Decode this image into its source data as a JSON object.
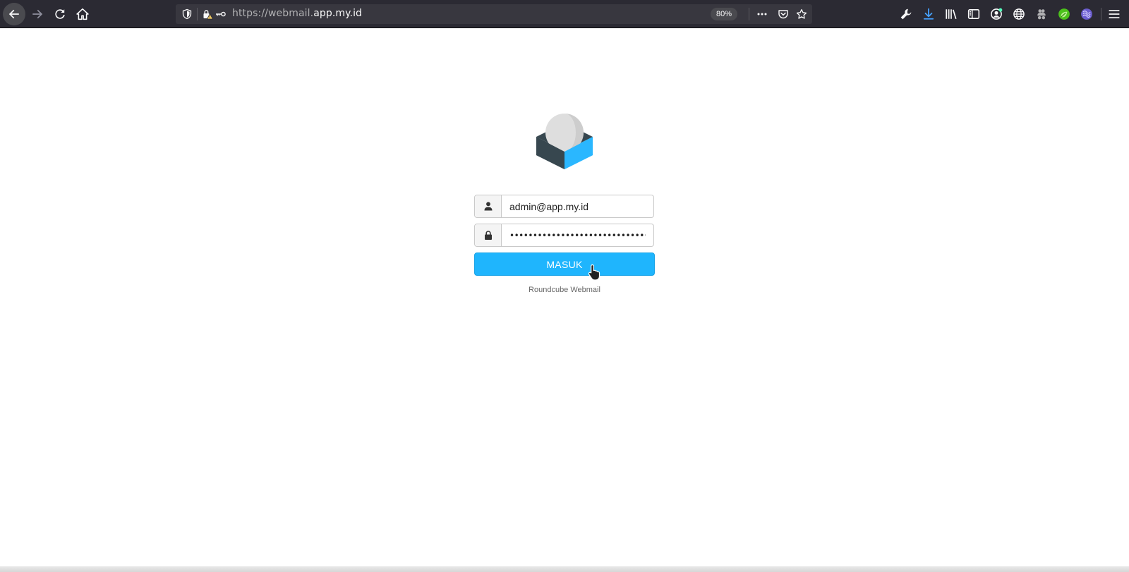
{
  "browser": {
    "url_prefix": "https://webmail.",
    "url_host": "app.my.id",
    "zoom": "80%",
    "icons": {
      "back": "back-arrow-icon",
      "forward": "forward-arrow-icon",
      "reload": "reload-icon",
      "home": "home-icon",
      "tracking": "tracking-shield-icon",
      "insecure": "insecure-lock-icon",
      "key": "key-icon",
      "more": "more-actions-icon",
      "pocket": "pocket-icon",
      "bookmark": "bookmark-star-icon",
      "devtools": "wrench-icon",
      "downloads": "download-icon",
      "library": "library-icon",
      "sidebar": "sidebar-icon",
      "account": "account-icon",
      "vpn": "globe-icon",
      "extension_1": "puzzle-extension-icon",
      "extension_2": "leaf-extension-icon",
      "extension_3": "purple-extension-icon",
      "menu": "hamburger-menu-icon"
    },
    "accent_download": "#45a1ff"
  },
  "login": {
    "username_value": "admin@app.my.id",
    "password_value": "••••••••••••••••••••••••••••••••",
    "submit_label": "MASUK",
    "product_name": "Roundcube Webmail",
    "button_color": "#1fb5fd",
    "logo_icon": "roundcube-logo"
  }
}
